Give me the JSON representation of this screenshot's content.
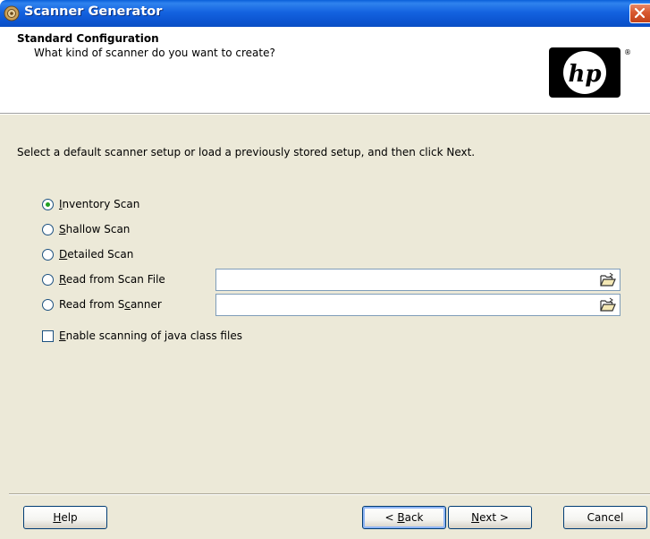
{
  "window": {
    "title": "Scanner Generator"
  },
  "header": {
    "title": "Standard Configuration",
    "subtitle": "What kind of scanner do you want to create?",
    "logo_text": "hp",
    "logo_mark": "®"
  },
  "main": {
    "intro": "Select a default scanner setup or load a previously stored setup, and then click Next.",
    "options": [
      {
        "key": "I",
        "rest": "nventory Scan",
        "selected": true
      },
      {
        "key": "S",
        "rest": "hallow Scan",
        "selected": false
      },
      {
        "key": "D",
        "rest": "etailed Scan",
        "selected": false
      },
      {
        "key": "R",
        "rest": "ead from Scan File",
        "selected": false,
        "field_value": ""
      },
      {
        "pre": "Read from S",
        "key": "c",
        "rest": "anner",
        "selected": false,
        "field_value": ""
      }
    ],
    "checkbox": {
      "key": "E",
      "rest": "nable scanning of java class files",
      "checked": false
    }
  },
  "footer": {
    "help": {
      "key": "H",
      "rest": "elp"
    },
    "back": {
      "pre": "< ",
      "key": "B",
      "rest": "ack"
    },
    "next": {
      "key": "N",
      "rest": "ext >"
    },
    "cancel": "Cancel"
  },
  "colors": {
    "titlebar": "#0b54d0",
    "dialog_bg": "#ece9d8",
    "radio_dot": "#21a121",
    "close_button": "#d8582f"
  },
  "icons": {
    "app": "scanner-generator-app-icon",
    "close": "close-icon",
    "browse": "folder-open-icon"
  }
}
